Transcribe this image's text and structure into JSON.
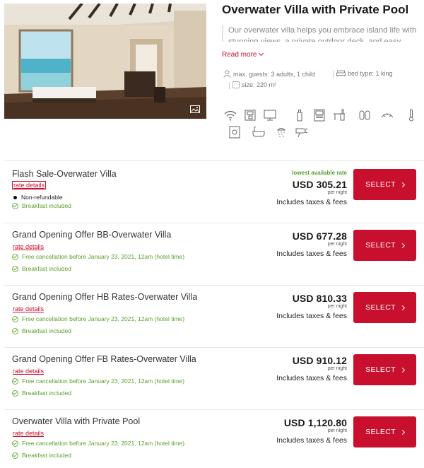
{
  "room": {
    "title": "Overwater Villa with Private Pool",
    "description_line1": "Our overwater villa helps you embrace island life with",
    "description_line2": "stunning views, a private outdoor deck, and easy",
    "read_more": "Read more",
    "facts": {
      "guests": "max. guests: 3 adults, 1 child",
      "bed": "bed type: 1 king",
      "size": "size: 220 m²"
    },
    "amenity_icons": [
      "wifi-icon",
      "coffee-maker-icon",
      "tv-icon",
      "toiletries-icon",
      "minibar-icon",
      "desk-icon",
      "slippers-icon",
      "hairdryer-icon",
      "thermometer-icon",
      "safe-icon",
      "bathtub-icon",
      "shower-icon",
      "hairdryer-2-icon"
    ]
  },
  "rates": [
    {
      "name": "Flash Sale-Overwater Villa",
      "details_label": "rate details",
      "lowest_label": "lowest available rate",
      "price": "USD 305.21",
      "per_night": "per night",
      "taxes": "Includes taxes & fees",
      "lines": [
        {
          "type": "policy",
          "text": "Non-refundable"
        },
        {
          "type": "benefit",
          "text": "Breakfast included"
        }
      ],
      "select_label": "SELECT"
    },
    {
      "name": "Grand Opening Offer BB-Overwater Villa",
      "details_label": "rate details",
      "price": "USD 677.28",
      "per_night": "per night",
      "taxes": "Includes taxes & fees",
      "lines": [
        {
          "type": "benefit",
          "text": "Free cancellation before January 23, 2021, 12am (hotel time)"
        },
        {
          "type": "benefit",
          "text": "Breakfast included"
        }
      ],
      "select_label": "SELECT"
    },
    {
      "name": "Grand Opening Offer HB Rates-Overwater Villa",
      "details_label": "rate details",
      "price": "USD 810.33",
      "per_night": "per night",
      "taxes": "Includes taxes & fees",
      "lines": [
        {
          "type": "benefit",
          "text": "Free cancellation before January 23, 2021, 12am (hotel time)"
        },
        {
          "type": "benefit",
          "text": "Breakfast included"
        }
      ],
      "select_label": "SELECT"
    },
    {
      "name": "Grand Opening Offer FB Rates-Overwater Villa",
      "details_label": "rate details",
      "price": "USD 910.12",
      "per_night": "per night",
      "taxes": "Includes taxes & fees",
      "lines": [
        {
          "type": "benefit",
          "text": "Free cancellation before January 23, 2021, 12am (hotel time)"
        },
        {
          "type": "benefit",
          "text": "Breakfast included"
        }
      ],
      "select_label": "SELECT"
    },
    {
      "name": "Overwater Villa with Private Pool",
      "details_label": "rate details",
      "price": "USD 1,120.80",
      "per_night": "per night",
      "taxes": "Includes taxes & fees",
      "lines": [
        {
          "type": "benefit",
          "text": "Free cancellation before January 23, 2021, 12am (hotel time)"
        },
        {
          "type": "benefit",
          "text": "Breakfast included"
        }
      ],
      "select_label": "SELECT"
    }
  ],
  "colors": {
    "brand_red": "#c8102e",
    "benefit_green": "#5aa02c"
  }
}
